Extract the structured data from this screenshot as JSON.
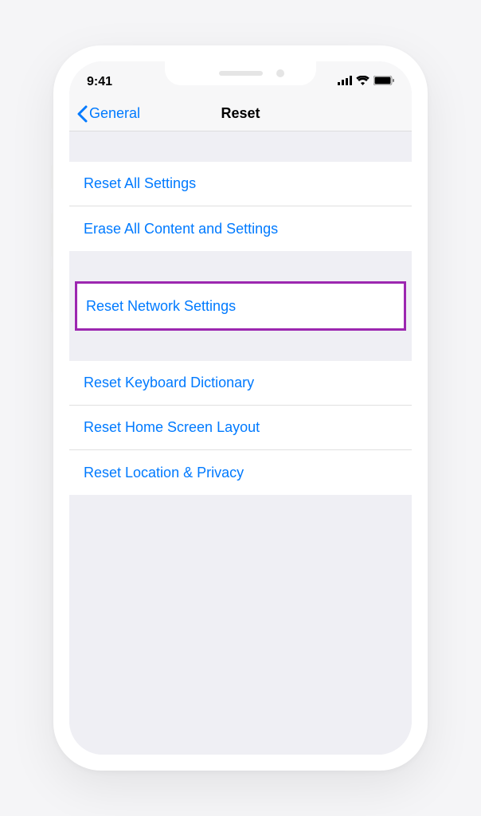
{
  "status_bar": {
    "time": "9:41"
  },
  "nav": {
    "back_label": "General",
    "title": "Reset"
  },
  "groups": {
    "g1": {
      "item1": "Reset All Settings",
      "item2": "Erase All Content and Settings"
    },
    "g2": {
      "item1": "Reset Network Settings"
    },
    "g3": {
      "item1": "Reset Keyboard Dictionary",
      "item2": "Reset Home Screen Layout",
      "item3": "Reset Location & Privacy"
    }
  },
  "highlight_color": "#9c27b0"
}
